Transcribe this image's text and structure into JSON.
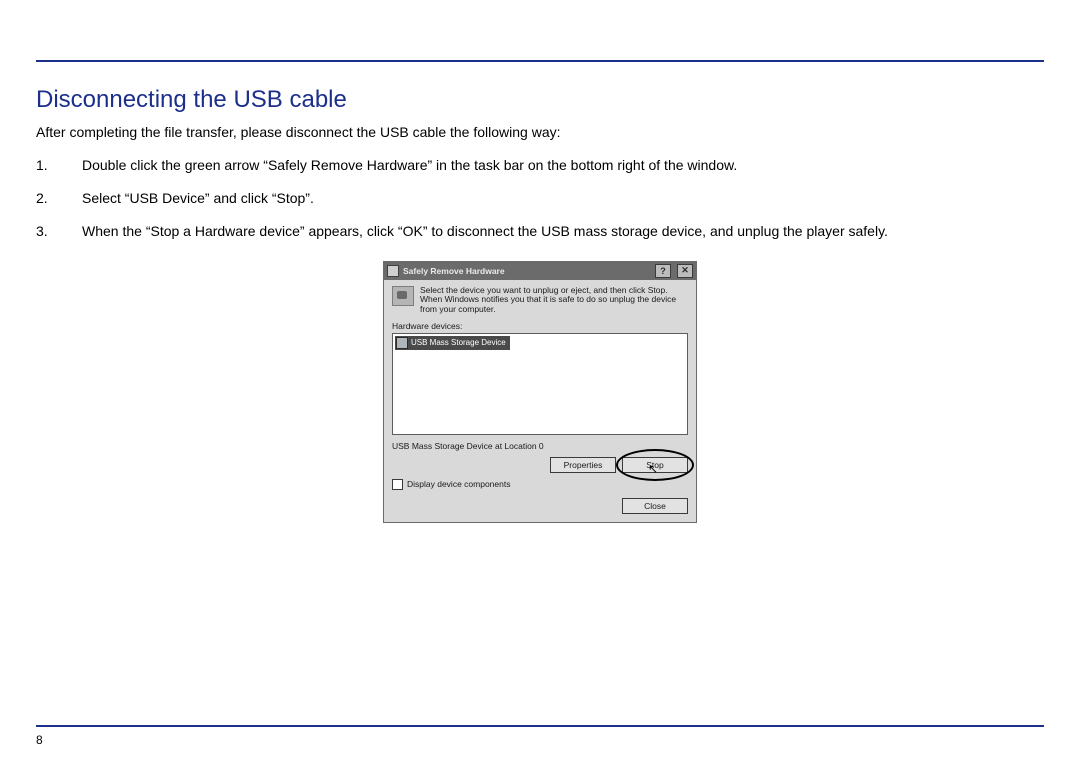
{
  "title": "Disconnecting the USB cable",
  "intro": "After completing the file transfer, please disconnect the USB cable the following way:",
  "steps": [
    "Double click the green arrow “Safely Remove Hardware” in the task bar on the bottom right of the window.",
    "Select “USB Device” and click “Stop”.",
    "When the “Stop a Hardware device” appears, click “OK” to disconnect the USB mass storage device, and unplug the player safely."
  ],
  "dialog": {
    "title": "Safely Remove Hardware",
    "help_btn": "?",
    "close_btn": "✕",
    "instruction": "Select the device you want to unplug or eject, and then click Stop. When Windows notifies you that it is safe to do so unplug the device from your computer.",
    "devices_label": "Hardware devices:",
    "list_item": "USB Mass Storage Device",
    "selection_text": "USB Mass Storage Device at Location 0",
    "properties_btn": "Properties",
    "stop_btn": "Stop",
    "checkbox_label": "Display device components",
    "close_action_btn": "Close"
  },
  "page_number": "8"
}
